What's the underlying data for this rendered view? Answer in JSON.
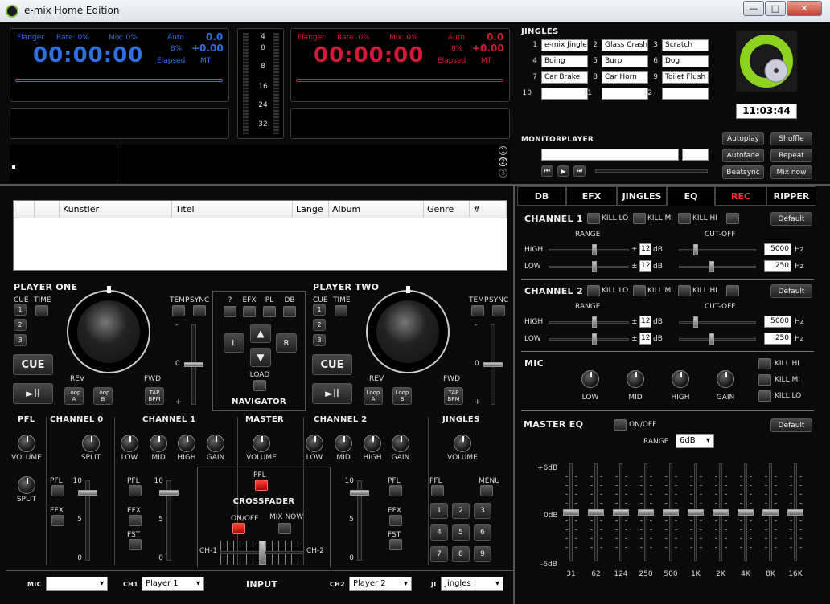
{
  "window": {
    "title": "e-mix Home Edition",
    "min": "—",
    "max": "□",
    "close": "✕"
  },
  "deck1": {
    "flanger": "Flanger",
    "rate": "Rate: 0%",
    "mix": "Mix: 0%",
    "auto": "Auto",
    "val1": "0.0",
    "time": "00:00:00",
    "pct": "8%",
    "pitch": "+0.00",
    "elapsed": "Elapsed",
    "mt": "MT"
  },
  "deck2": {
    "flanger": "Flanger",
    "rate": "Rate: 0%",
    "mix": "Mix: 0%",
    "auto": "Auto",
    "val1": "0.0",
    "time": "00:00:00",
    "pct": "8%",
    "pitch": "+0.00",
    "elapsed": "Elapsed",
    "mt": "MT"
  },
  "meter": {
    "ticks": [
      "4",
      "0",
      "8",
      "16",
      "24",
      "32"
    ]
  },
  "wavemarks": [
    "1",
    "2",
    "3"
  ],
  "jingles": {
    "title": "JINGLES",
    "slots": [
      {
        "n": "1",
        "name": "e-mix Jingle"
      },
      {
        "n": "2",
        "name": "Glass Crash"
      },
      {
        "n": "3",
        "name": "Scratch"
      },
      {
        "n": "4",
        "name": "Boing"
      },
      {
        "n": "5",
        "name": "Burp"
      },
      {
        "n": "6",
        "name": "Dog"
      },
      {
        "n": "7",
        "name": "Car Brake"
      },
      {
        "n": "8",
        "name": "Car Horn"
      },
      {
        "n": "9",
        "name": "Toilet Flush"
      },
      {
        "n": "10",
        "name": ""
      },
      {
        "n": "11",
        "name": ""
      },
      {
        "n": "12",
        "name": ""
      }
    ]
  },
  "clock": "11:03:44",
  "monitor": {
    "title": "MONITORPLAYER"
  },
  "autobtns": [
    "Autoplay",
    "Shuffle",
    "Autofade",
    "Repeat",
    "Beatsync",
    "Mix now"
  ],
  "playlist": {
    "cols": [
      "",
      "",
      "Künstler",
      "Titel",
      "Länge",
      "Album",
      "Genre",
      "#"
    ]
  },
  "tabs": [
    "DB",
    "EFX",
    "JINGLES",
    "EQ",
    "REC",
    "RIPPER"
  ],
  "accent": {
    "rec": "#ff3030",
    "blue": "#2f6fe0",
    "red": "#d11a3a"
  },
  "eq": {
    "ch1": {
      "title": "CHANNEL 1",
      "kill": [
        "KILL LO",
        "KILL MI",
        "KILL HI"
      ],
      "default": "Default",
      "range": "RANGE",
      "cutoff": "CUT-OFF",
      "high": "HIGH",
      "low": "LOW",
      "db1": "12",
      "db2": "12",
      "pm": "±",
      "dbunit": "dB",
      "hz1": "5000",
      "hz2": "250",
      "hz": "Hz"
    },
    "ch2": {
      "title": "CHANNEL 2",
      "kill": [
        "KILL LO",
        "KILL MI",
        "KILL HI"
      ],
      "default": "Default",
      "range": "RANGE",
      "cutoff": "CUT-OFF",
      "high": "HIGH",
      "low": "LOW",
      "db1": "12",
      "db2": "12",
      "pm": "±",
      "dbunit": "dB",
      "hz1": "5000",
      "hz2": "250",
      "hz": "Hz"
    },
    "mic": {
      "title": "MIC",
      "knobs": [
        "LOW",
        "MID",
        "HIGH",
        "GAIN"
      ],
      "kills": [
        "KILL HI",
        "KILL MI",
        "KILL LO"
      ]
    },
    "master": {
      "title": "MASTER EQ",
      "onoff": "ON/OFF",
      "default": "Default",
      "range": "RANGE",
      "range_val": "6dB",
      "scale": [
        "+6dB",
        "0dB",
        "-6dB"
      ],
      "bands": [
        {
          "f": "31",
          "v": 0
        },
        {
          "f": "62",
          "v": 0
        },
        {
          "f": "124",
          "v": 0
        },
        {
          "f": "250",
          "v": 0
        },
        {
          "f": "500",
          "v": 0
        },
        {
          "f": "1K",
          "v": 0
        },
        {
          "f": "2K",
          "v": 0
        },
        {
          "f": "4K",
          "v": 0
        },
        {
          "f": "8K",
          "v": 0
        },
        {
          "f": "16K",
          "v": 0
        }
      ]
    }
  },
  "player1": {
    "title": "PLAYER ONE",
    "cue": "CUE",
    "time": "TIME",
    "hot": [
      "1",
      "2",
      "3"
    ],
    "cuebig": "CUE",
    "play": "►II",
    "rev": "REV",
    "fwd": "FWD",
    "loopa": "Loop A",
    "loopb": "Loop B",
    "tap": "TAP BPM",
    "temp": "TEMP",
    "sync": "SYNC",
    "scale": [
      "-",
      "0",
      "+"
    ]
  },
  "player2": {
    "title": "PLAYER TWO",
    "cue": "CUE",
    "time": "TIME",
    "hot": [
      "1",
      "2",
      "3"
    ],
    "cuebig": "CUE",
    "play": "►II",
    "rev": "REV",
    "fwd": "FWD",
    "loopa": "Loop A",
    "loopb": "Loop B",
    "tap": "TAP BPM",
    "temp": "TEMP",
    "sync": "SYNC",
    "scale": [
      "-",
      "0",
      "+"
    ]
  },
  "navigator": {
    "title": "NAVIGATOR",
    "top": [
      "?",
      "EFX",
      "PL",
      "DB"
    ],
    "l": "L",
    "r": "R",
    "load": "LOAD"
  },
  "mixer": {
    "pfl": "PFL",
    "ch0": "CHANNEL 0",
    "ch1": "CHANNEL 1",
    "master": "MASTER",
    "ch2": "CHANNEL 2",
    "jingles": "JINGLES",
    "volume": "VOLUME",
    "split": "SPLIT",
    "low": "LOW",
    "mid": "MID",
    "high": "HIGH",
    "gain": "GAIN",
    "efx": "EFX",
    "fst": "FST",
    "menu": "MENU",
    "scale": [
      "10",
      "5",
      "0"
    ],
    "crossfader": "CROSSFADER",
    "onoff": "ON/OFF",
    "mixnow": "MIX NOW",
    "ch1lbl": "CH-1",
    "ch2lbl": "CH-2",
    "pads": [
      "1",
      "2",
      "3",
      "4",
      "5",
      "6",
      "7",
      "8",
      "9"
    ]
  },
  "bottom": {
    "mic": "MIC",
    "ch1": "CH1",
    "ch1_val": "Player 1",
    "input": "INPUT",
    "ch2": "CH2",
    "ch2_val": "Player 2",
    "ji": "JI",
    "ji_val": "Jingles"
  }
}
